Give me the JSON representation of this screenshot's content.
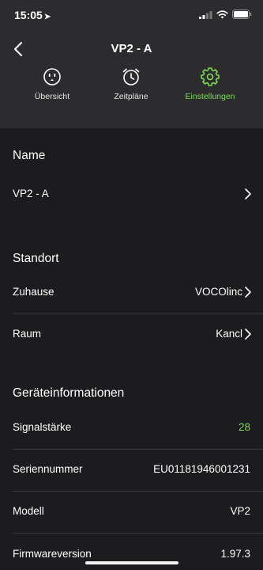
{
  "status_bar": {
    "time": "15:05",
    "location_arrow": "➤"
  },
  "header": {
    "title": "VP2 - A",
    "tabs": [
      {
        "label": "Übersicht",
        "icon": "outlet-icon",
        "active": false
      },
      {
        "label": "Zeitpläne",
        "icon": "alarm-clock-icon",
        "active": false
      },
      {
        "label": "Einstellungen",
        "icon": "gear-icon",
        "active": true
      }
    ]
  },
  "sections": {
    "name": {
      "title": "Name",
      "value": "VP2 - A"
    },
    "location": {
      "title": "Standort",
      "home_label": "Zuhause",
      "home_value": "VOCOlinc",
      "room_label": "Raum",
      "room_value": "Kancl"
    },
    "device_info": {
      "title": "Geräteinformationen",
      "signal_label": "Signalstärke",
      "signal_value": "28",
      "serial_label": "Seriennummer",
      "serial_value": "EU01181946001231",
      "model_label": "Modell",
      "model_value": "VP2",
      "firmware_label": "Firmwareversion",
      "firmware_value": "1.97.3"
    }
  },
  "colors": {
    "accent": "#7ed957",
    "background": "#1c1c1e",
    "header_background": "#2c2c2e"
  }
}
